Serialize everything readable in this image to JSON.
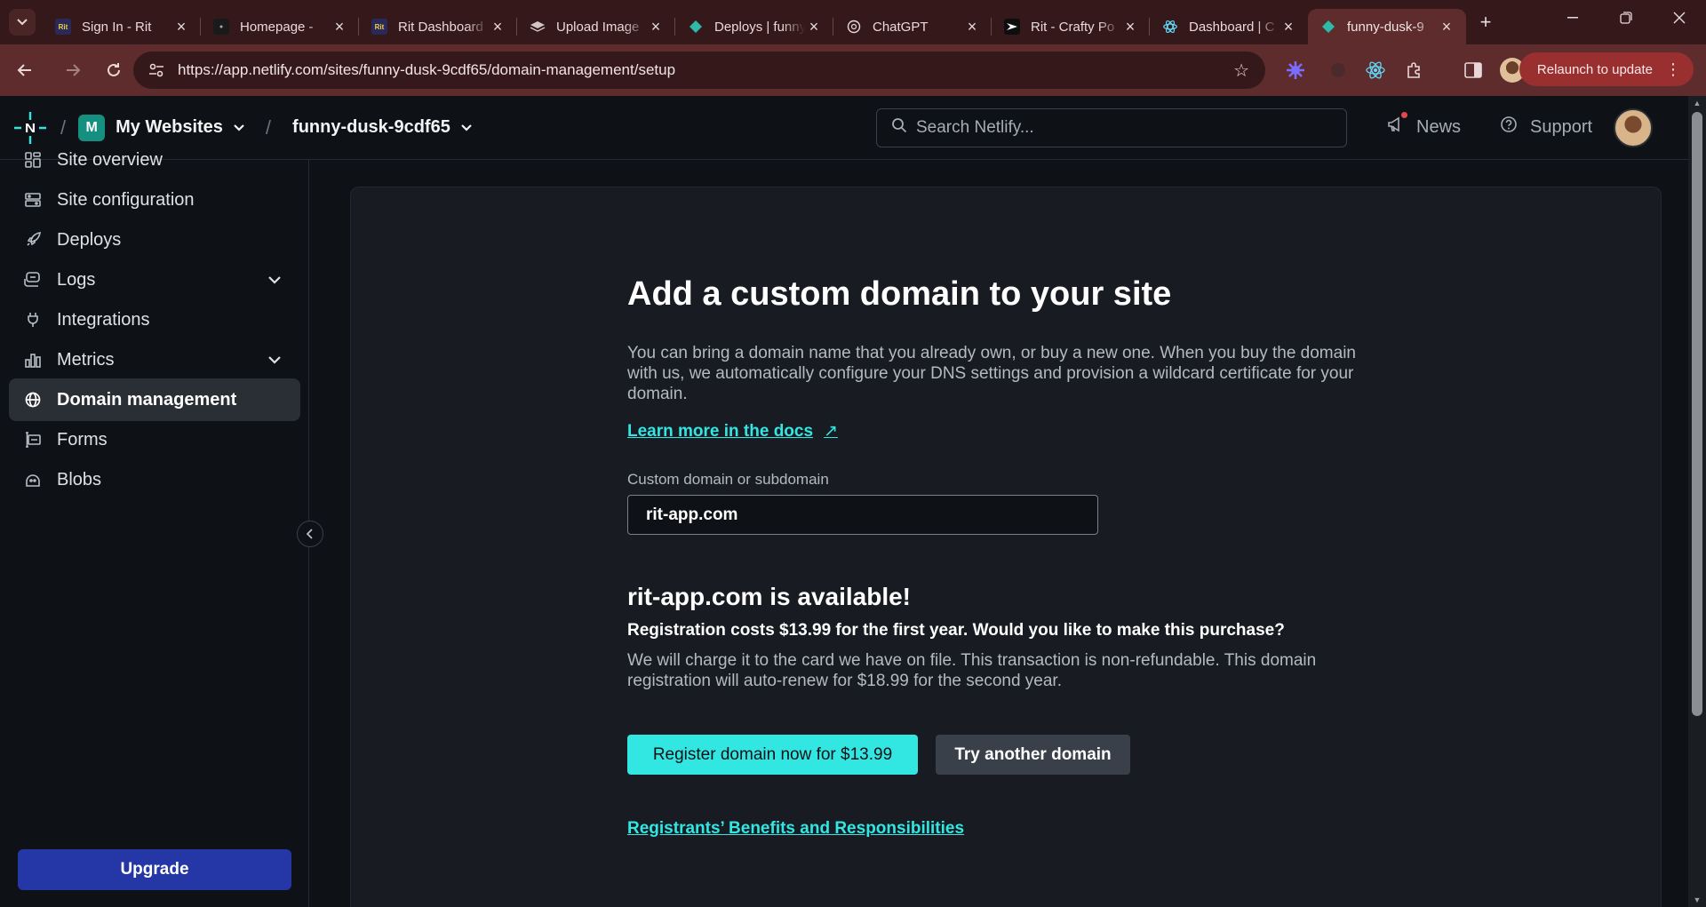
{
  "browser": {
    "tabs": [
      {
        "title": "Sign In - Rit",
        "favicon": "rit-favicon",
        "favicon_text": "Rit"
      },
      {
        "title": "Homepage - ",
        "favicon": "dark-favicon",
        "favicon_text": ""
      },
      {
        "title": "Rit Dashboard",
        "favicon": "rit-favicon",
        "favicon_text": "Rit"
      },
      {
        "title": "Upload Image",
        "favicon": "stack-favicon",
        "favicon_text": ""
      },
      {
        "title": "Deploys | funny",
        "favicon": "netlify-favicon",
        "favicon_text": ""
      },
      {
        "title": "ChatGPT",
        "favicon": "chatgpt-favicon",
        "favicon_text": ""
      },
      {
        "title": "Rit - Crafty Po",
        "favicon": "crafty-favicon",
        "favicon_text": ""
      },
      {
        "title": "Dashboard | C",
        "favicon": "react-favicon",
        "favicon_text": ""
      },
      {
        "title": "funny-dusk-9",
        "favicon": "netlify-favicon",
        "favicon_text": ""
      }
    ],
    "active_tab_index": 8,
    "url": "https://app.netlify.com/sites/funny-dusk-9cdf65/domain-management/setup",
    "relaunch_label": "Relaunch to update"
  },
  "header": {
    "team_initial": "M",
    "team_name": "My Websites",
    "site_name": "funny-dusk-9cdf65",
    "search_placeholder": "Search Netlify...",
    "news_label": "News",
    "support_label": "Support"
  },
  "sidebar": {
    "items": [
      {
        "label": "Site overview",
        "icon": "grid-icon",
        "expandable": false
      },
      {
        "label": "Site configuration",
        "icon": "config-icon",
        "expandable": false
      },
      {
        "label": "Deploys",
        "icon": "rocket-icon",
        "expandable": false
      },
      {
        "label": "Logs",
        "icon": "logs-icon",
        "expandable": true
      },
      {
        "label": "Integrations",
        "icon": "plug-icon",
        "expandable": false
      },
      {
        "label": "Metrics",
        "icon": "bar-chart-icon",
        "expandable": true
      },
      {
        "label": "Domain management",
        "icon": "globe-icon",
        "expandable": false
      },
      {
        "label": "Forms",
        "icon": "form-icon",
        "expandable": false
      },
      {
        "label": "Blobs",
        "icon": "blob-icon",
        "expandable": false
      }
    ],
    "active_index": 6,
    "upgrade_label": "Upgrade"
  },
  "main": {
    "heading": "Add a custom domain to your site",
    "intro": "You can bring a domain name that you already own, or buy a new one. When you buy the domain with us, we automatically configure your DNS settings and provision a wildcard certificate for your domain.",
    "docs_link": "Learn more in the docs",
    "docs_link_arrow": "↗",
    "field_label": "Custom domain or subdomain",
    "field_value": "rit-app.com",
    "availability": "rit-app.com is available!",
    "cost_question": "Registration costs $13.99 for the first year. Would you like to make this purchase?",
    "charge_note": "We will charge it to the card we have on file. This transaction is non-refundable. This domain registration will auto-renew for $18.99 for the second year.",
    "register_button": "Register domain now for $13.99",
    "try_another_button": "Try another domain",
    "registrants_link": "Registrants’ Benefits and Responsibilities"
  },
  "colors": {
    "accent": "#32e6e2",
    "upgrade": "#2536a6",
    "tab_bar": "#35191a",
    "toolbar": "#5e2c2d"
  }
}
